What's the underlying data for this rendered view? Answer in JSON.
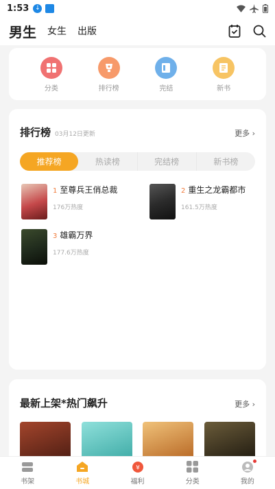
{
  "status_bar": {
    "time": "1:53"
  },
  "top_nav": {
    "tabs": [
      "男生",
      "女生",
      "出版"
    ]
  },
  "categories": [
    {
      "label": "分类",
      "color": "#f07272"
    },
    {
      "label": "排行榜",
      "color": "#f79a6a"
    },
    {
      "label": "完结",
      "color": "#6fb0ea"
    },
    {
      "label": "新书",
      "color": "#f7c463"
    }
  ],
  "ranking": {
    "title": "排行榜",
    "date": "03月12日更新",
    "more": "更多",
    "tabs": [
      "推荐榜",
      "热读榜",
      "完结榜",
      "新书榜"
    ],
    "books": [
      {
        "rank": "1",
        "title": "至尊兵王俏总裁",
        "heat": "176万热度",
        "cover": "#c5484a"
      },
      {
        "rank": "2",
        "title": "重生之龙霸都市",
        "heat": "161.5万热度",
        "cover": "#2b2b2b"
      },
      {
        "rank": "3",
        "title": "雄霸万界",
        "heat": "177.6万热度",
        "cover": "#1f2a1c"
      }
    ]
  },
  "new_section": {
    "title": "最新上架*热门飙升",
    "more": "更多",
    "covers": [
      "#7a2f1e",
      "#5fc6c2",
      "#d98c3a",
      "#3d3626"
    ]
  },
  "bottom_nav": [
    {
      "label": "书架"
    },
    {
      "label": "书城"
    },
    {
      "label": "福利"
    },
    {
      "label": "分类"
    },
    {
      "label": "我的"
    }
  ]
}
